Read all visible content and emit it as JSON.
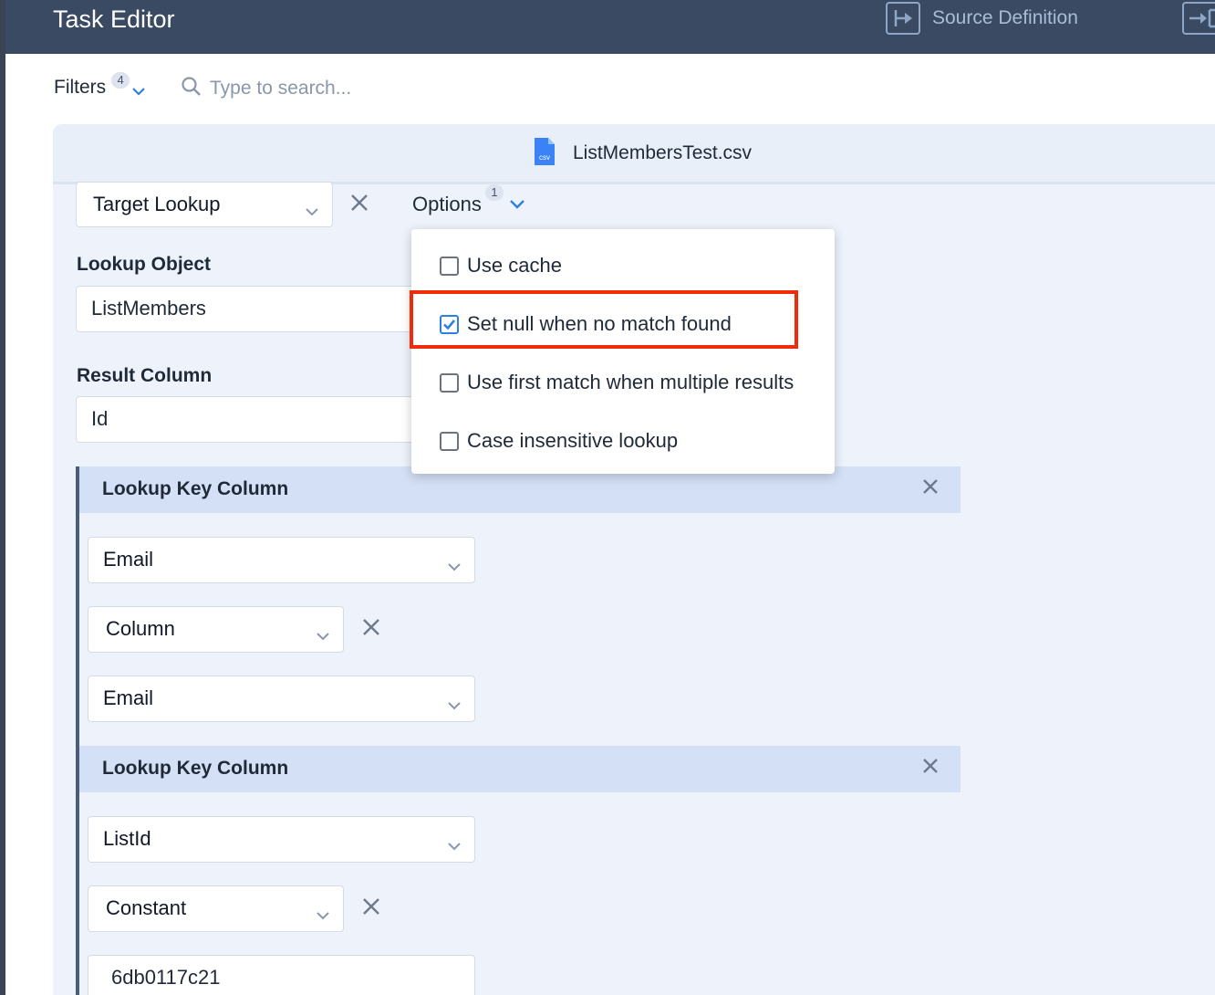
{
  "header": {
    "title": "Task Editor",
    "source_definition_label": "Source Definition"
  },
  "toolbar": {
    "filters_label": "Filters",
    "filters_count": "4",
    "search_placeholder": "Type to search..."
  },
  "file": {
    "name": "ListMembersTest.csv",
    "icon_text": "csv"
  },
  "task": {
    "type_value": "Target Lookup",
    "options_label": "Options",
    "options_count": "1"
  },
  "options_menu": {
    "items": [
      {
        "label": "Use cache",
        "checked": false
      },
      {
        "label": "Set null when no match found",
        "checked": true
      },
      {
        "label": "Use first match when multiple results",
        "checked": false
      },
      {
        "label": "Case insensitive lookup",
        "checked": false
      }
    ]
  },
  "fields": {
    "lookup_object_label": "Lookup Object",
    "lookup_object_value": "ListMembers",
    "result_column_label": "Result Column",
    "result_column_value": "Id"
  },
  "lookup_keys": [
    {
      "title": "Lookup Key Column",
      "key_column": "Email",
      "source_type": "Column",
      "source_value": "Email"
    },
    {
      "title": "Lookup Key Column",
      "key_column": "ListId",
      "source_type": "Constant",
      "source_value": "6db0117c21"
    }
  ],
  "colors": {
    "header_bg": "#3a4a62",
    "panel_bg": "#eef3fb",
    "group_header_bg": "#d4e0f6",
    "accent": "#2f7fe0",
    "highlight": "#f02b0a"
  }
}
